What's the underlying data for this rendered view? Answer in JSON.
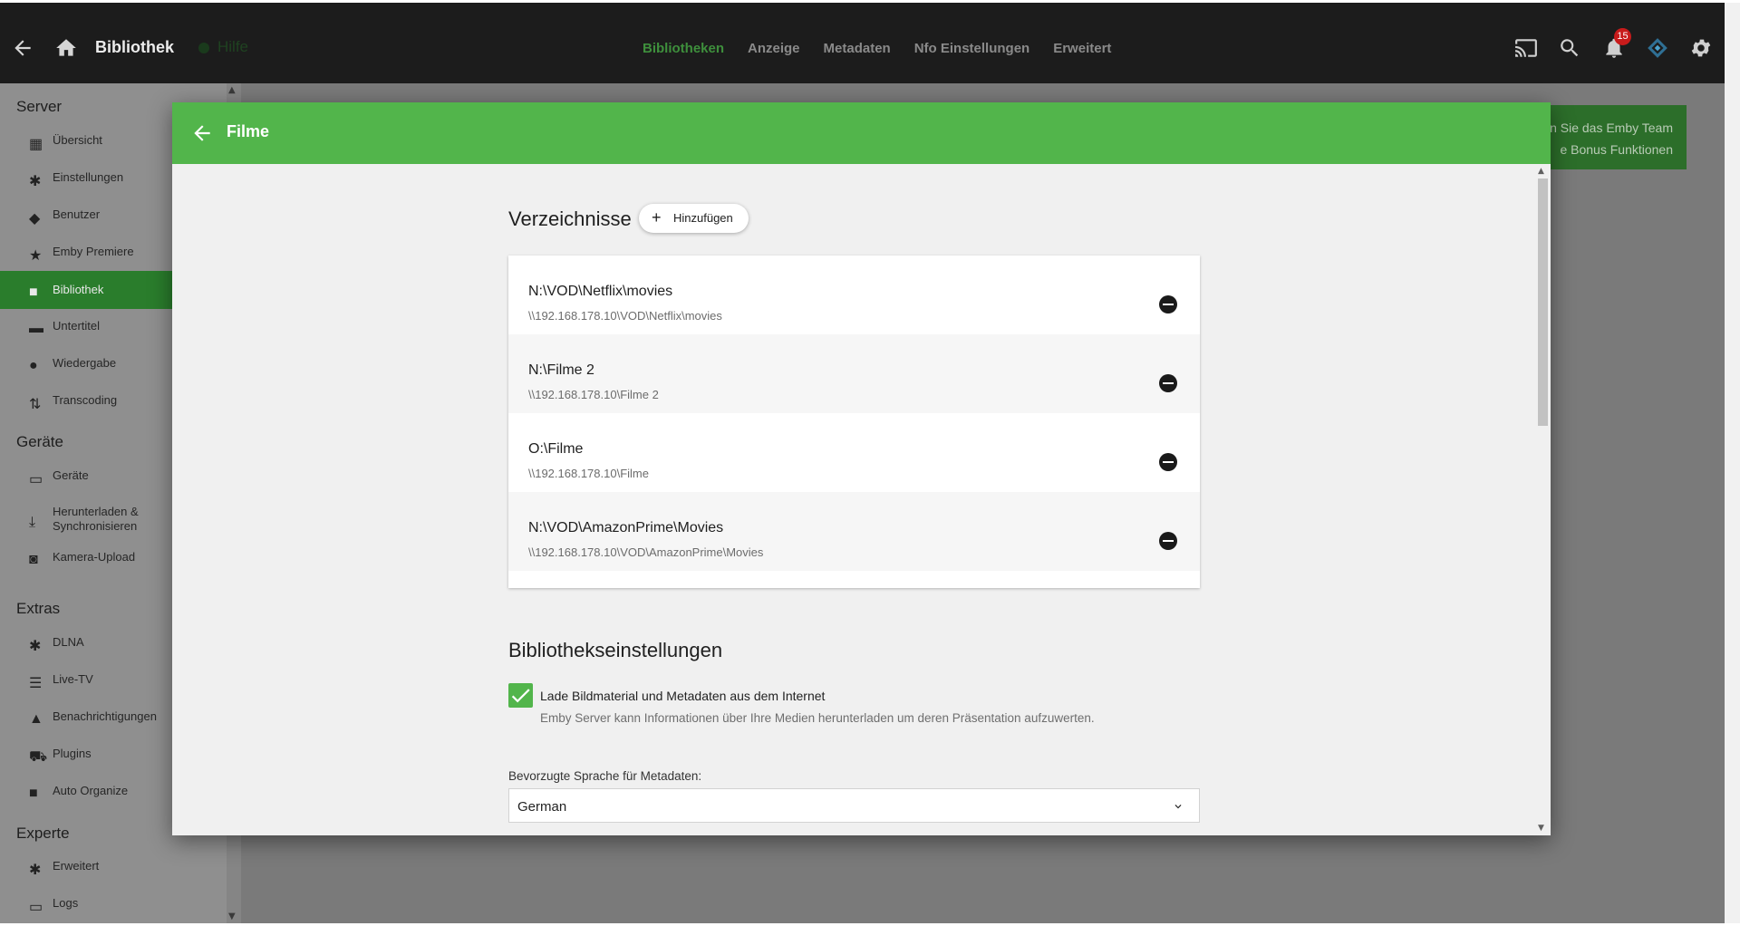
{
  "header": {
    "title": "Bibliothek",
    "help_label": "Hilfe",
    "tabs": [
      "Bibliotheken",
      "Anzeige",
      "Metadaten",
      "Nfo Einstellungen",
      "Erweitert"
    ],
    "active_tab": "Bibliotheken",
    "notification_count": "15",
    "icons": [
      "back-icon",
      "home-icon",
      "cast-icon",
      "search-icon",
      "bell-icon",
      "kodi-icon",
      "gear-icon"
    ]
  },
  "sidebar": {
    "sections": [
      {
        "heading": "Server",
        "items": [
          "Übersicht",
          "Einstellungen",
          "Benutzer",
          "Emby Premiere",
          "Bibliothek",
          "Untertitel",
          "Wiedergabe",
          "Transcoding"
        ]
      },
      {
        "heading": "Geräte",
        "items": [
          "Geräte",
          "Herunterladen & Synchronisieren",
          "Kamera-Upload"
        ]
      },
      {
        "heading": "Extras",
        "items": [
          "DLNA",
          "Live-TV",
          "Benachrichtigungen",
          "Plugins",
          "Auto Organize"
        ]
      },
      {
        "heading": "Experte",
        "items": [
          "Erweitert",
          "Logs"
        ]
      }
    ],
    "active_item": "Bibliothek"
  },
  "banner": {
    "line1": "n Sie das Emby Team",
    "line2": "e Bonus Funktionen"
  },
  "dialog": {
    "title": "Filme",
    "folders_heading": "Verzeichnisse",
    "add_label": "Hinzufügen",
    "paths": [
      {
        "path": "N:\\VOD\\Netflix\\movies",
        "network_path": "\\\\192.168.178.10\\VOD\\Netflix\\movies"
      },
      {
        "path": "N:\\Filme 2",
        "network_path": "\\\\192.168.178.10\\Filme 2"
      },
      {
        "path": "O:\\Filme",
        "network_path": "\\\\192.168.178.10\\Filme"
      },
      {
        "path": "N:\\VOD\\AmazonPrime\\Movies",
        "network_path": "\\\\192.168.178.10\\VOD\\AmazonPrime\\Movies"
      }
    ],
    "settings_heading": "Bibliothekseinstellungen",
    "download_checkbox": {
      "label": "Lade Bildmaterial und Metadaten aus dem Internet",
      "help": "Emby Server kann Informationen über Ihre Medien herunterladen um deren Präsentation aufzuwerten.",
      "checked": true
    },
    "language": {
      "label": "Bevorzugte Sprache für Metadaten:",
      "value": "German"
    }
  },
  "colors": {
    "accent": "#52b54b",
    "header_bg": "#1c1c1c",
    "badge": "#c81b1b"
  }
}
